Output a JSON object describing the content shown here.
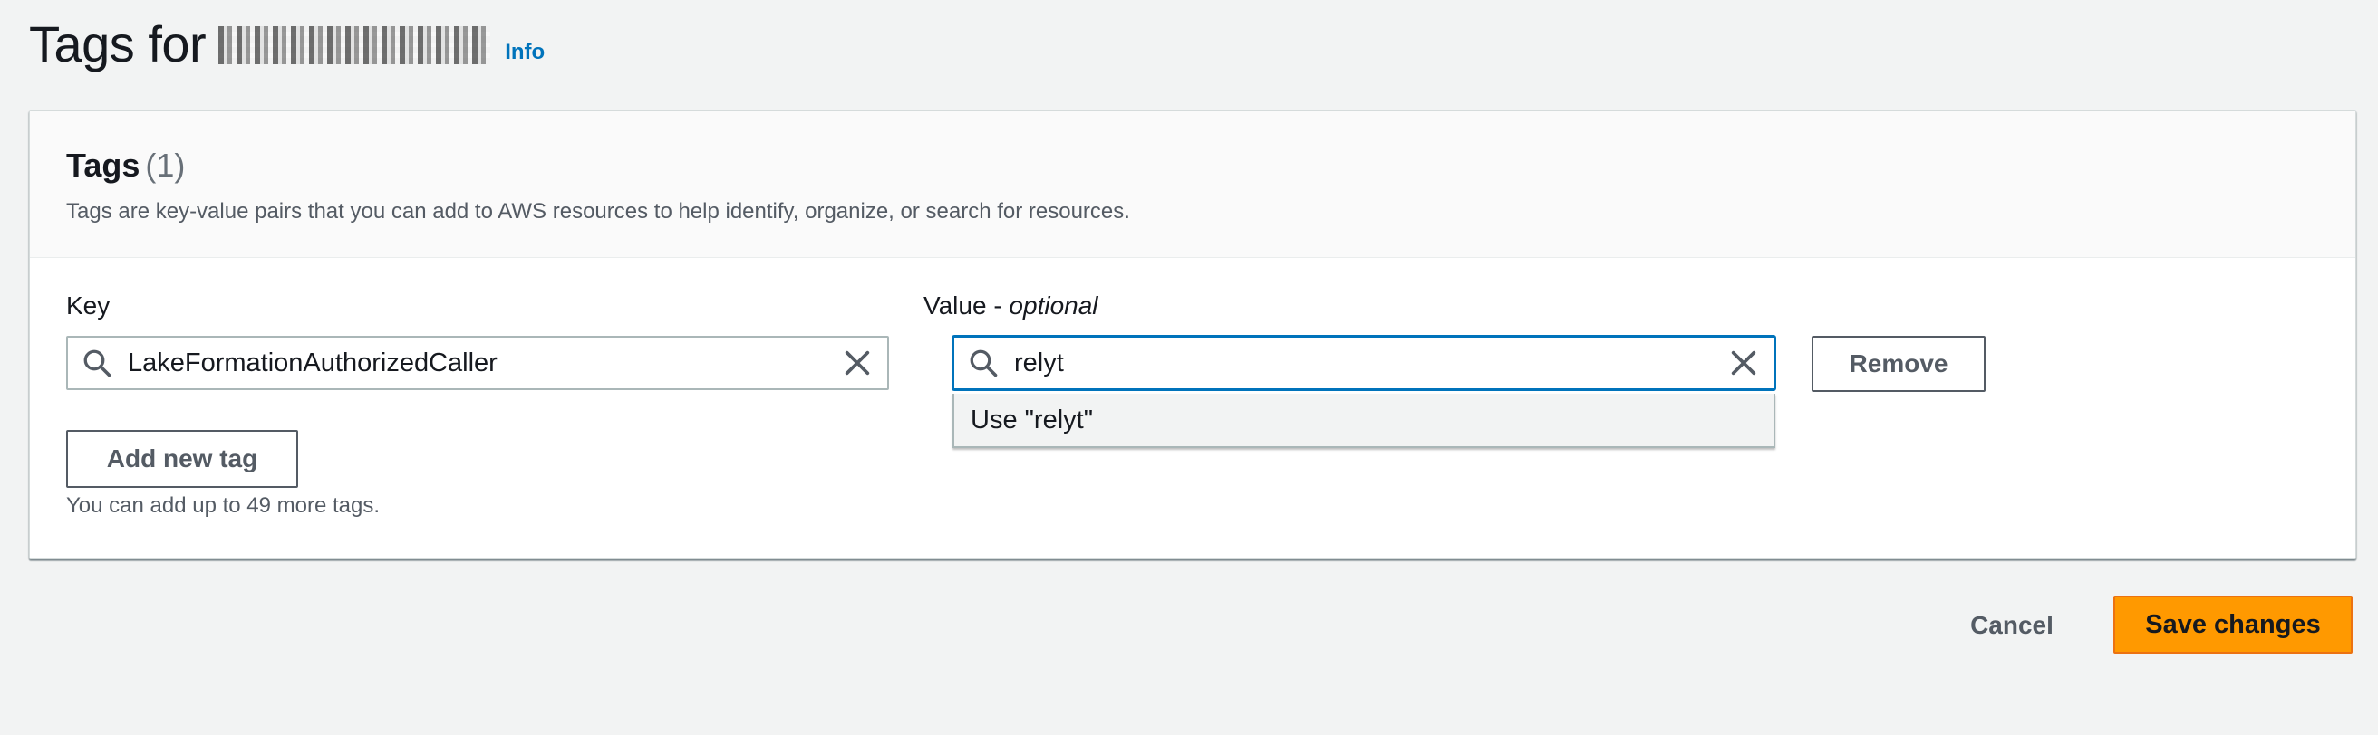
{
  "header": {
    "title": "Tags for",
    "info_link": "Info"
  },
  "tags_panel": {
    "title": "Tags",
    "count": "(1)",
    "description": "Tags are key-value pairs that you can add to AWS resources to help identify, organize, or search for resources.",
    "key_label": "Key",
    "value_label": "Value - ",
    "value_label_optional": "optional",
    "rows": [
      {
        "key": "LakeFormationAuthorizedCaller",
        "value": "relyt",
        "remove_label": "Remove"
      }
    ],
    "suggestion": "Use \"relyt\"",
    "add_tag_label": "Add new tag",
    "limit_hint": "You can add up to 49 more tags."
  },
  "footer": {
    "cancel_label": "Cancel",
    "save_label": "Save changes"
  },
  "colors": {
    "link": "#0073bb",
    "primary_button": "#ff9900",
    "focus_border": "#0073bb",
    "page_background": "#f2f3f3"
  },
  "icons": [
    "search-icon",
    "close-icon"
  ]
}
